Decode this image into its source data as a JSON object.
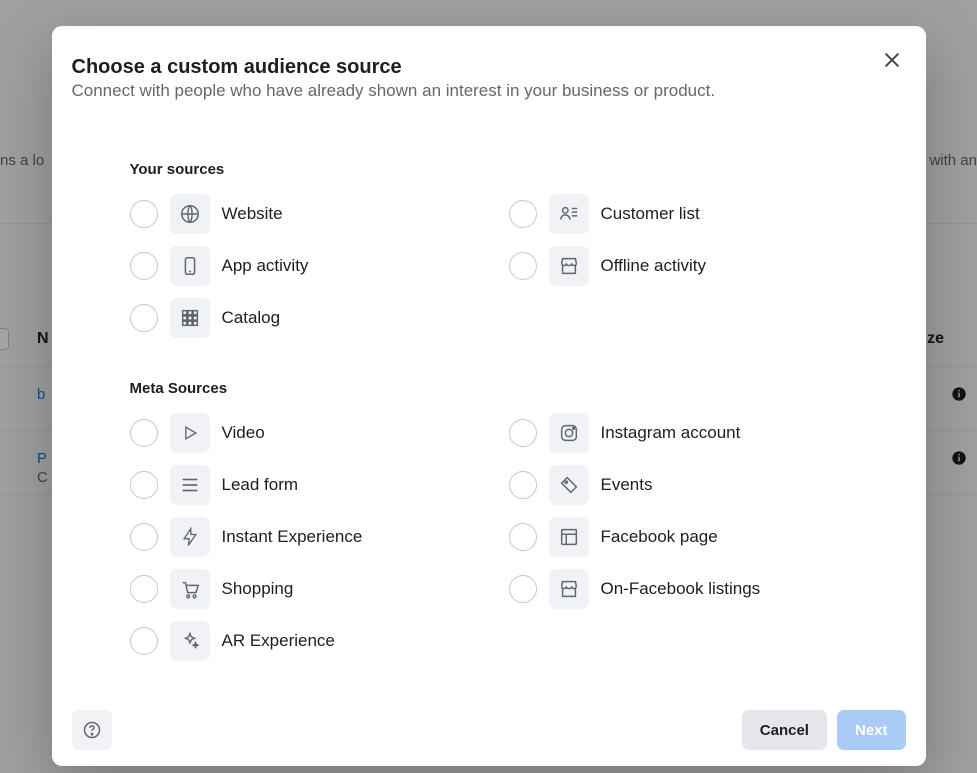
{
  "modal": {
    "title": "Choose a custom audience source",
    "subtitle": "Connect with people who have already shown an interest in your business or product.",
    "sections": {
      "your_sources": {
        "heading": "Your sources",
        "items": [
          {
            "label": "Website"
          },
          {
            "label": "Customer list"
          },
          {
            "label": "App activity"
          },
          {
            "label": "Offline activity"
          },
          {
            "label": "Catalog"
          }
        ]
      },
      "meta_sources": {
        "heading": "Meta Sources",
        "items": [
          {
            "label": "Video"
          },
          {
            "label": "Instagram account"
          },
          {
            "label": "Lead form"
          },
          {
            "label": "Events"
          },
          {
            "label": "Instant Experience"
          },
          {
            "label": "Facebook page"
          },
          {
            "label": "Shopping"
          },
          {
            "label": "On-Facebook listings"
          },
          {
            "label": "AR Experience"
          }
        ]
      }
    },
    "buttons": {
      "cancel": "Cancel",
      "next": "Next"
    }
  },
  "bg": {
    "hint_left": "ns a lo",
    "hint_right": "with an",
    "col_n": "N",
    "col_size": "ize",
    "row0": "b",
    "row1_a": "P",
    "row1_b": "C"
  }
}
